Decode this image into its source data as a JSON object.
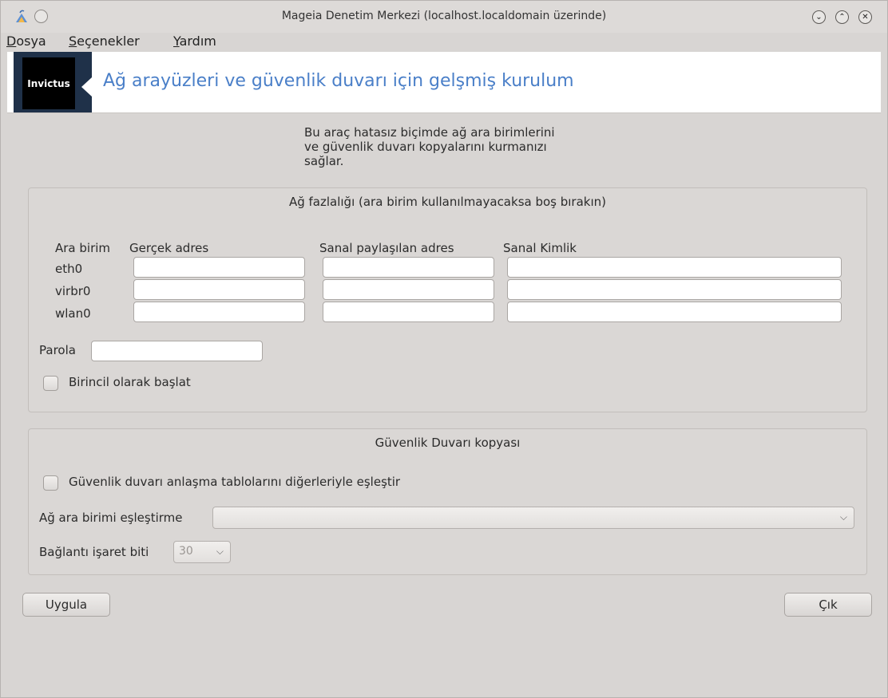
{
  "window": {
    "title": "Mageia Denetim Merkezi  (localhost.localdomain üzerinde)"
  },
  "menu": {
    "items": [
      {
        "accel": "D",
        "rest": "osya"
      },
      {
        "accel": "S",
        "rest": "eçenekler"
      },
      {
        "accel": "Y",
        "rest": "ardım"
      }
    ]
  },
  "banner": {
    "logo_text": "Invictus",
    "title": "Ağ arayüzleri ve güvenlik duvarı için gelşmiş kurulum"
  },
  "description": {
    "lines": [
      "Bu araç hatasız biçimde ağ ara birimlerini",
      "ve güvenlik duvarı kopyalarını kurmanızı",
      "sağlar."
    ]
  },
  "redundancy": {
    "title": "Ağ fazlalığı (ara birim kullanılmayacaksa boş bırakın)",
    "headers": {
      "interface": "Ara birim",
      "real_address": "Gerçek adres",
      "virtual_shared_address": "Sanal paylaşılan adres",
      "virtual_id": "Sanal Kimlik"
    },
    "rows": [
      {
        "name": "eth0",
        "real": "",
        "shared": "",
        "vid": ""
      },
      {
        "name": "virbr0",
        "real": "",
        "shared": "",
        "vid": ""
      },
      {
        "name": "wlan0",
        "real": "",
        "shared": "",
        "vid": ""
      }
    ],
    "password_label": "Parola",
    "password_value": "",
    "start_primary_label": "Birincil olarak başlat",
    "start_primary_checked": false
  },
  "firewall": {
    "title": "Güvenlik Duvarı kopyası",
    "sync_label": "Güvenlik duvarı anlaşma tablolarını diğerleriyle eşleştir",
    "sync_checked": false,
    "iface_label": "Ağ ara birimi eşleştirme",
    "iface_value": "",
    "mark_label": "Bağlantı işaret biti",
    "mark_value": "30"
  },
  "buttons": {
    "apply": "Uygula",
    "quit": "Çık"
  },
  "colors": {
    "banner_title": "#4a7fc8",
    "logo_bg": "#000000",
    "banner_edge": "#1f3149",
    "window_bg": "#d8d5d3"
  }
}
